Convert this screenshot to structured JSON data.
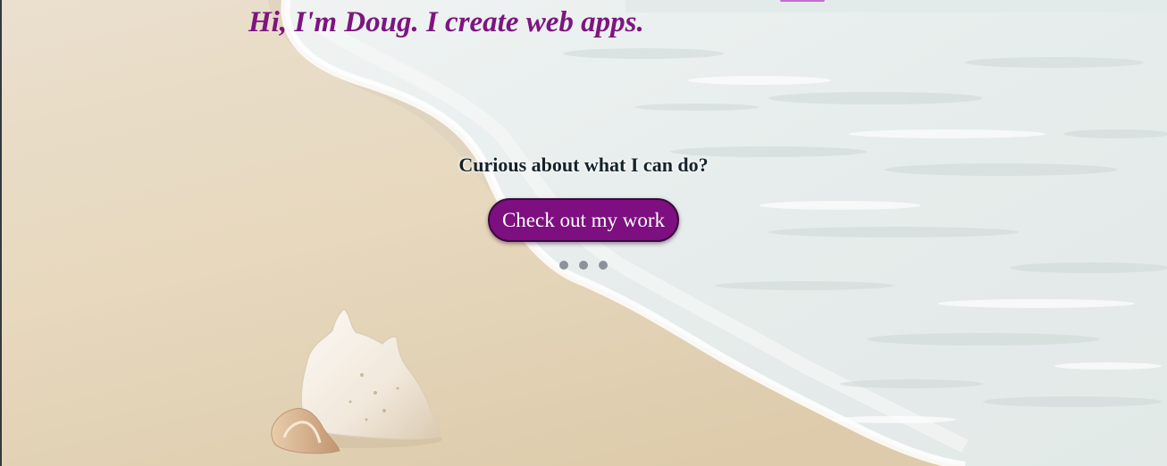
{
  "hero": {
    "headline": "Hi, I'm Doug. I create web apps.",
    "tagline": "Curious about what I can do?",
    "cta_label": "Check out my work",
    "background": "beach-with-conch-shell-image",
    "indicator_dots": 3
  },
  "colors": {
    "headline": "#7d1580",
    "button": "#7d0f80",
    "button_text": "#ffffff",
    "tagline": "#14232b",
    "dots": "#8b929a"
  }
}
